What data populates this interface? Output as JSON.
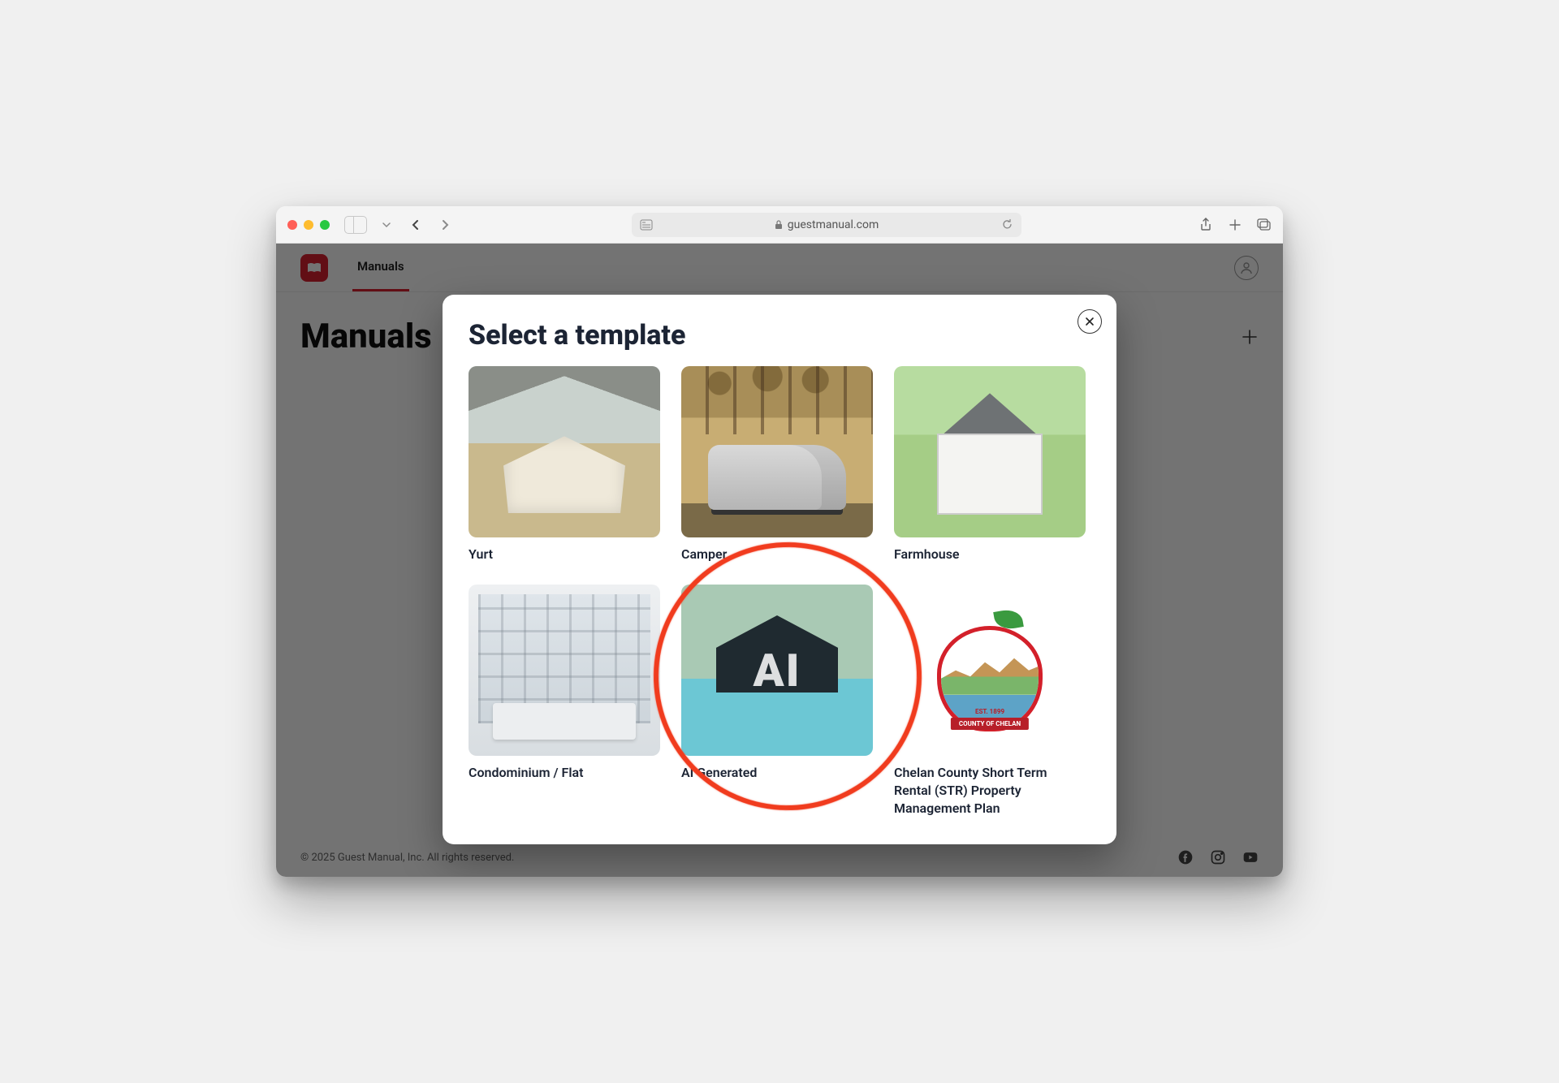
{
  "browser": {
    "url_display": "guestmanual.com"
  },
  "nav": {
    "tabs": [
      "Manuals"
    ]
  },
  "page": {
    "title": "Manuals"
  },
  "footer": {
    "copyright": "© 2025 Guest Manual, Inc. All rights reserved."
  },
  "modal": {
    "title": "Select a template",
    "templates": [
      {
        "label": "Yurt"
      },
      {
        "label": "Camper"
      },
      {
        "label": "Farmhouse"
      },
      {
        "label": "Condominium / Flat"
      },
      {
        "label": "AI Generated"
      },
      {
        "label": "Chelan County Short Term Rental (STR) Property Management Plan"
      }
    ],
    "chelan_banner": "COUNTY OF CHELAN",
    "chelan_est": "EST. 1899"
  }
}
